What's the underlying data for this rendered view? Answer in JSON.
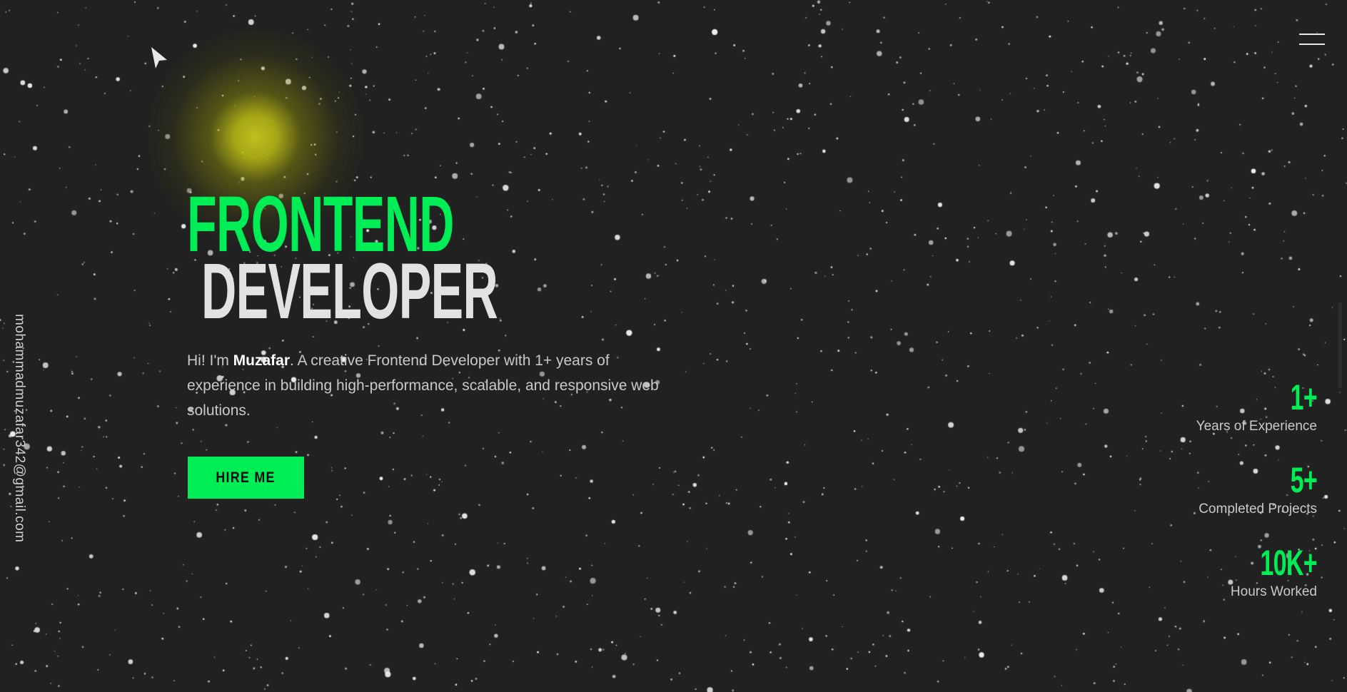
{
  "header": {
    "menu_icon": "hamburger-menu-icon"
  },
  "cursor": {
    "icon": "pointer-arrow-icon"
  },
  "sidebar": {
    "email": "mohammadmuzafar342@gmail.com"
  },
  "hero": {
    "title_line1": "FRONTEND",
    "title_line2": "DEVELOPER",
    "intro_prefix": "Hi! I'm ",
    "intro_name": "Muzafar",
    "intro_rest": ". A creative Frontend Developer with 1+ years of experience in building high-performance, scalable, and responsive web solutions.",
    "cta_label": "HIRE ME"
  },
  "stats": [
    {
      "value": "1+",
      "label": "Years of Experience"
    },
    {
      "value": "5+",
      "label": "Completed Projects"
    },
    {
      "value": "10K+",
      "label": "Hours Worked"
    }
  ],
  "colors": {
    "accent": "#00ee55",
    "background": "#212121",
    "title_secondary": "#e2e2e2",
    "glow": "#c8c81e"
  }
}
